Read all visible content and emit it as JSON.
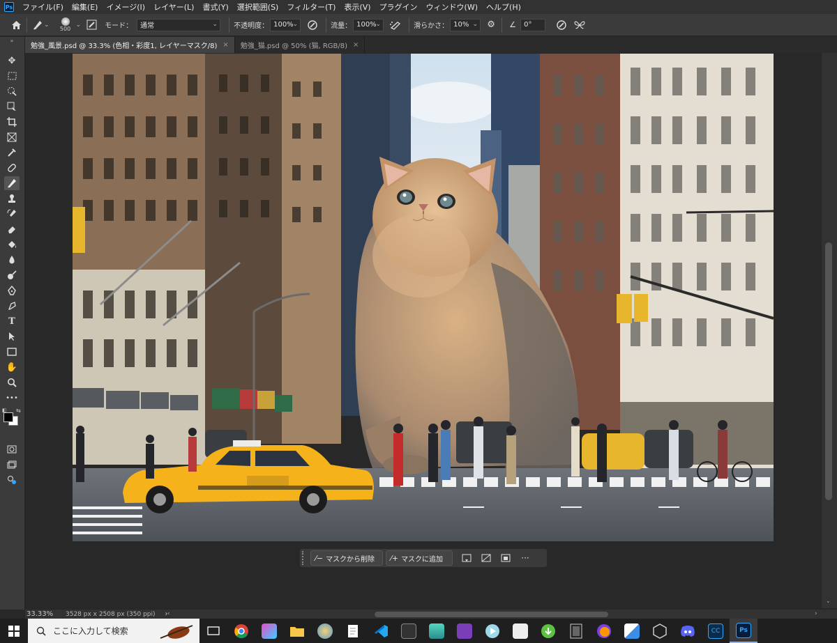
{
  "menu": [
    "ファイル(F)",
    "編集(E)",
    "イメージ(I)",
    "レイヤー(L)",
    "書式(Y)",
    "選択範囲(S)",
    "フィルター(T)",
    "表示(V)",
    "プラグイン",
    "ウィンドウ(W)",
    "ヘルプ(H)"
  ],
  "logo": "Ps",
  "options": {
    "brush_size": "500",
    "mode_label": "モード：",
    "mode_value": "通常",
    "opacity_label": "不透明度：",
    "opacity_value": "100%",
    "flow_label": "流量：",
    "flow_value": "100%",
    "smooth_label": "滑らかさ：",
    "smooth_value": "10%",
    "angle_value": "0°"
  },
  "tabs": [
    {
      "label": "勉強_風景.psd @ 33.3% (色相・彩度1, レイヤーマスク/8)",
      "close": "×",
      "active": true
    },
    {
      "label": "勉強_猫.psd @ 50% (猫, RGB/8)",
      "close": "×",
      "active": false
    }
  ],
  "status": {
    "zoom": "33.33%",
    "doc_info": "3528 px x 2508 px (350 ppi)",
    "arrow": "›"
  },
  "context_bar": {
    "remove_label": "マスクから削除",
    "add_label": "マスクに追加",
    "more": "···"
  },
  "taskbar": {
    "search_placeholder": "ここに入力して検索"
  },
  "colors": {
    "accent": "#31a8ff",
    "ui_dark": "#282828",
    "ui_panel": "#3b3b3b",
    "taxi": "#f5b21a"
  }
}
